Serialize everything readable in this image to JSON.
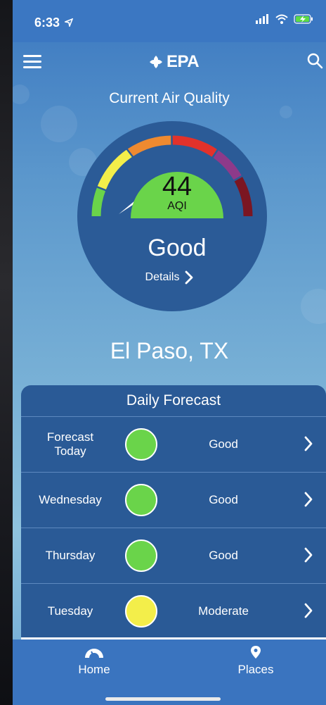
{
  "status": {
    "time": "6:33"
  },
  "header": {
    "logo_text": "EPA"
  },
  "current": {
    "title": "Current Air Quality",
    "aqi_value": "44",
    "aqi_unit": "AQI",
    "category": "Good",
    "details_label": "Details",
    "location": "El Paso, TX"
  },
  "forecast": {
    "title": "Daily Forecast",
    "days": [
      {
        "day": "Forecast Today",
        "level": "Good",
        "color": "#6ad44a"
      },
      {
        "day": "Wednesday",
        "level": "Good",
        "color": "#6ad44a"
      },
      {
        "day": "Thursday",
        "level": "Good",
        "color": "#6ad44a"
      },
      {
        "day": "Tuesday",
        "level": "Moderate",
        "color": "#f3ee4a"
      }
    ]
  },
  "tabs": {
    "home": "Home",
    "places": "Places"
  },
  "colors": {
    "good": "#6ad44a",
    "moderate": "#f3ee4a",
    "usg": "#ee8a30",
    "unhealthy": "#e2322b",
    "very_unhealthy": "#8e3a8a",
    "hazardous": "#7b1622",
    "gauge_bg": "#2b5b97"
  }
}
